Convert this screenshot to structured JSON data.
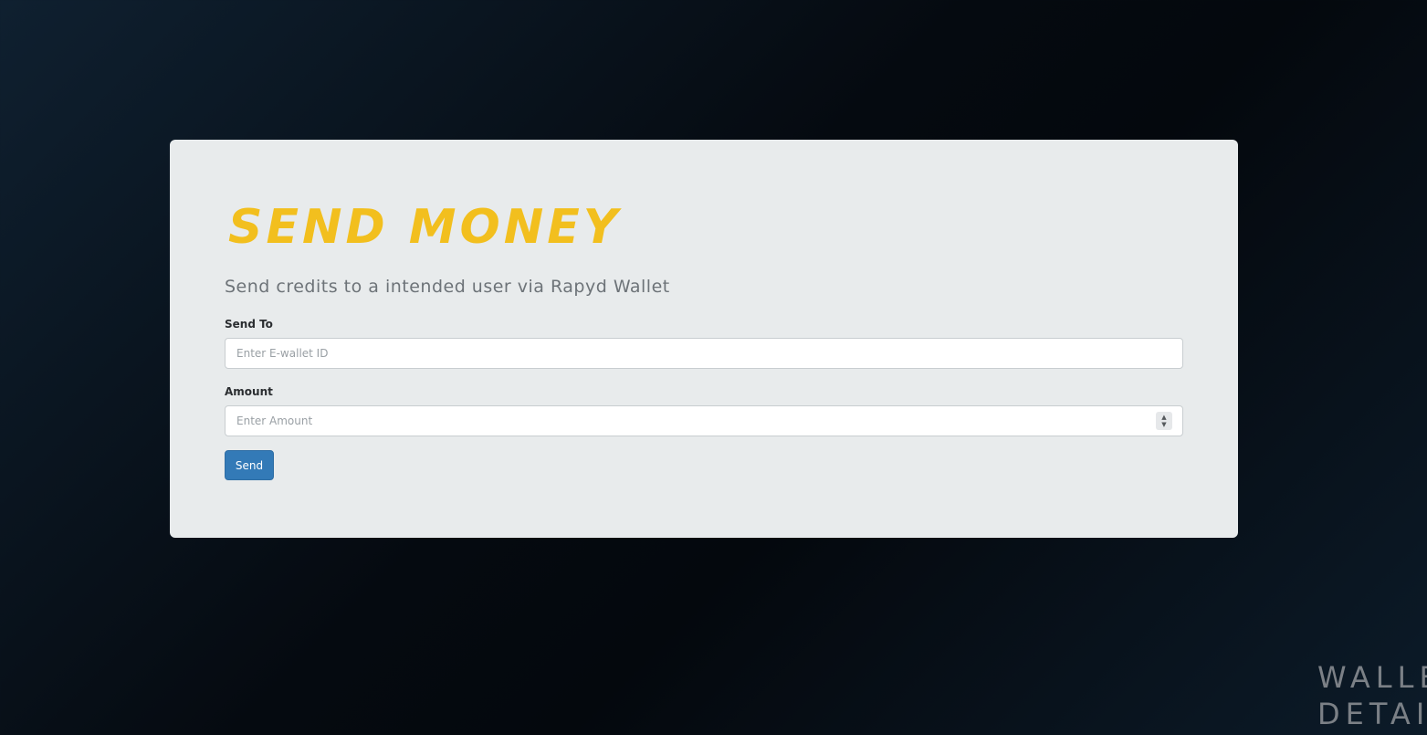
{
  "card": {
    "title": "SEND MONEY",
    "subtitle": "Send credits to a intended user via Rapyd Wallet"
  },
  "form": {
    "send_to": {
      "label": "Send To",
      "placeholder": "Enter E-wallet ID",
      "value": ""
    },
    "amount": {
      "label": "Amount",
      "placeholder": "Enter Amount",
      "value": ""
    },
    "submit_label": "Send"
  },
  "background_text": {
    "line1": "WALLET",
    "line2": "DETAILS"
  },
  "colors": {
    "title": "#f2bf1e",
    "button": "#337ab7",
    "card": "#e8ebec"
  }
}
